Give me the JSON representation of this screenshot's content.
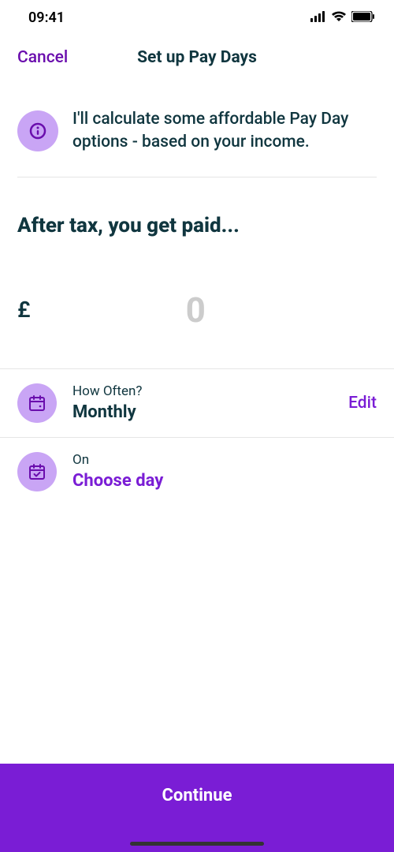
{
  "status": {
    "time": "09:41"
  },
  "header": {
    "cancel": "Cancel",
    "title": "Set up Pay Days"
  },
  "info": {
    "text": "I'll calculate some affordable Pay Day options - based on your income."
  },
  "section_heading": "After tax, you get paid...",
  "amount": {
    "currency": "£",
    "value": "0"
  },
  "frequency": {
    "label": "How Often?",
    "value": "Monthly",
    "edit": "Edit"
  },
  "day": {
    "label": "On",
    "value": "Choose day"
  },
  "continue": "Continue"
}
